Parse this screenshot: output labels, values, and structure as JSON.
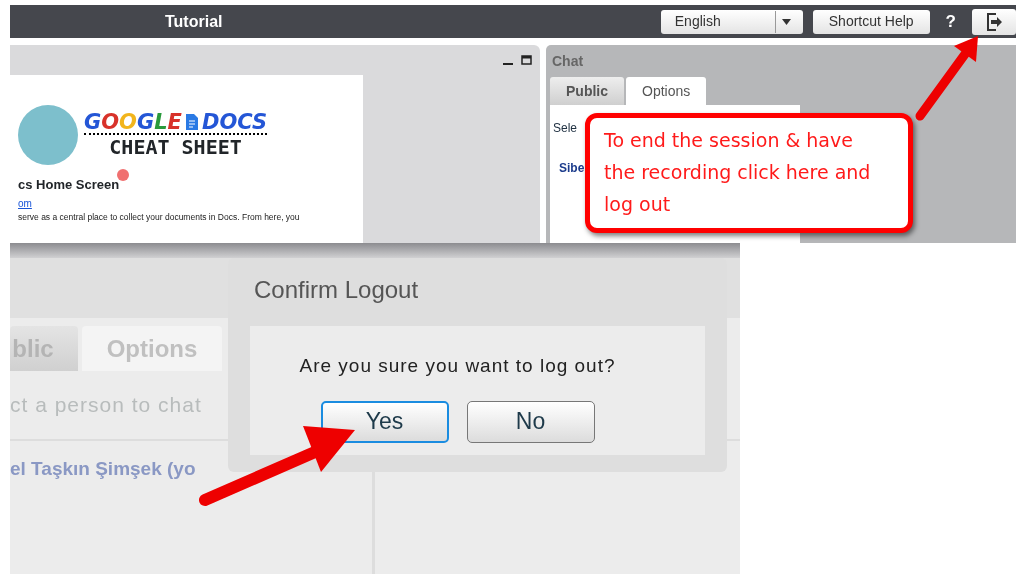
{
  "top_bar": {
    "title": "Tutorial",
    "language": {
      "value": "English"
    },
    "shortcut_help": "Shortcut Help",
    "help": "?"
  },
  "presentation_panel": {
    "logo": {
      "word_1": "GOOGLE",
      "word_2": "DOCS",
      "subtitle": "CHEAT SHEET"
    },
    "heading": "cs Home Screen",
    "link": "om",
    "paragraph": "serve as a central place to collect your documents in Docs. From here, you"
  },
  "chat_panel": {
    "title": "Chat",
    "tabs": [
      {
        "label": "Public",
        "selected": false
      },
      {
        "label": "Options",
        "selected": true
      }
    ],
    "select_text": "Sele",
    "user": "Sibe"
  },
  "callout": "To end the session & have the recording click here and log out",
  "zoomed_view": {
    "tabs": [
      {
        "label": "blic",
        "selected": false
      },
      {
        "label": "Options",
        "selected": true
      }
    ],
    "select_text": "ct a person to chat",
    "user": "el Taşkın Şimşek (yo",
    "dialog": {
      "title": "Confirm Logout",
      "message": "Are you sure you want to log out?",
      "buttons": [
        {
          "label": "Yes",
          "selected": true
        },
        {
          "label": "No",
          "selected": false
        }
      ]
    }
  }
}
